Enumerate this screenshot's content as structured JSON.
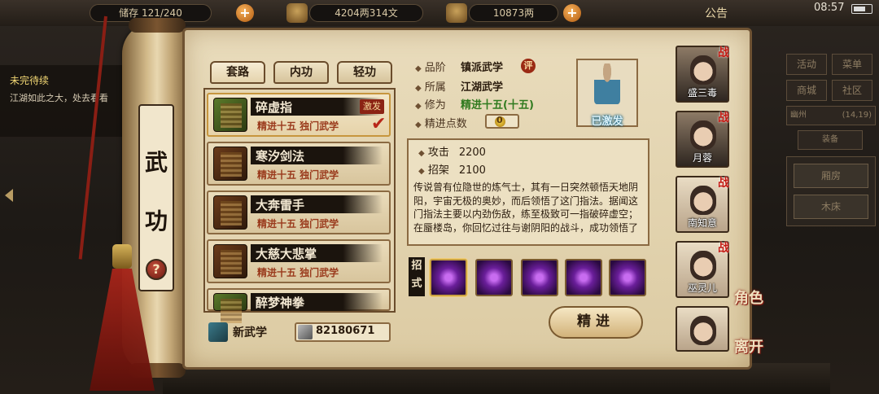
{
  "topbar": {
    "storage": "储存 121/240",
    "silver": "4204两314文",
    "gold": "10873两",
    "notice": "公告",
    "clock": "08:57"
  },
  "quest": {
    "title": "未完待续",
    "text": "江湖如此之大，处去看看"
  },
  "right_menu": {
    "buttons": [
      "活动",
      "菜单",
      "商城",
      "社区"
    ],
    "location": "幽州",
    "coords": "(14,19)",
    "bag": "装备",
    "rooms": [
      "厢房",
      "木床"
    ]
  },
  "scroll": {
    "title_chars": [
      "武",
      "功"
    ],
    "help": "?"
  },
  "tabs": [
    "套路",
    "内功",
    "轻功"
  ],
  "skills": [
    {
      "name": "碎虚指",
      "sub": "精进十五 独门武学",
      "badge": "激发",
      "selected": true,
      "book": "green"
    },
    {
      "name": "寒汐剑法",
      "sub": "精进十五 独门武学",
      "book": "brown"
    },
    {
      "name": "大奔雷手",
      "sub": "精进十五 独门武学",
      "book": "brown"
    },
    {
      "name": "大慈大悲掌",
      "sub": "精进十五 独门武学",
      "book": "brown"
    },
    {
      "name": "醉梦神拳",
      "sub": "",
      "book": "green"
    }
  ],
  "footer": {
    "new_skill": "新武学",
    "coins": "82180671"
  },
  "detail": {
    "grade_label": "品阶",
    "grade": "镇派武学",
    "grade_badge": "评",
    "belong_label": "所属",
    "belong": "江湖武学",
    "cultivation_label": "修为",
    "cultivation": "精进十五(十五)",
    "points_label": "精进点数",
    "points": "0",
    "activated": "已激发",
    "attack_label": "攻击",
    "attack": "2200",
    "parry_label": "招架",
    "parry": "2100",
    "description": "传说曾有位隐世的炼气士，其有一日突然顿悟天地阴阳，宇宙无极的奥妙，而后领悟了这门指法。据闻这门指法主要以内劲伤敌，练至极致可一指破碎虚空；在蜃楼岛，你回忆过往与谢阴阳的战斗，成功领悟了",
    "moves_label": "招式",
    "jingjin_button": "精进"
  },
  "characters": [
    {
      "name": "盛三毒",
      "zhan": "战"
    },
    {
      "name": "月蓉",
      "zhan": "战"
    },
    {
      "name": "南知意",
      "zhan": "战"
    },
    {
      "name": "巫灵儿",
      "zhan": "战"
    },
    {
      "name": "",
      "zhan": ""
    }
  ],
  "side_labels": {
    "role": "角色",
    "leave": "离开"
  },
  "colors": {
    "parchment": "#e9dcbc",
    "accent_red": "#9a3a1c",
    "green_text": "#2f7a1e"
  }
}
